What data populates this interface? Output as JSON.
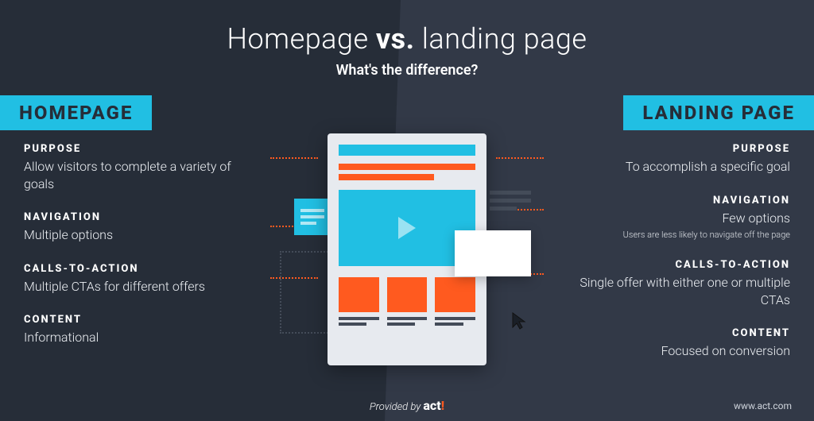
{
  "title_part1": "Homepage ",
  "title_vs": "vs.",
  "title_part2": " landing page",
  "subtitle": "What's the difference?",
  "tabs": {
    "left": "HOMEPAGE",
    "right": "LANDING PAGE"
  },
  "homepage": {
    "purpose": {
      "label": "PURPOSE",
      "text": "Allow visitors to complete a variety of goals"
    },
    "nav": {
      "label": "NAVIGATION",
      "text": "Multiple options"
    },
    "cta": {
      "label": "CALLS-TO-ACTION",
      "text": "Multiple CTAs for different offers"
    },
    "content": {
      "label": "CONTENT",
      "text": "Informational"
    }
  },
  "landing": {
    "purpose": {
      "label": "PURPOSE",
      "text": "To accomplish a specific goal"
    },
    "nav": {
      "label": "NAVIGATION",
      "text": "Few options",
      "sub": "Users are less likely to navigate off the page"
    },
    "cta": {
      "label": "CALLS-TO-ACTION",
      "text": "Single offer with either one or multiple CTAs"
    },
    "content": {
      "label": "CONTENT",
      "text": "Focused on conversion"
    }
  },
  "footer": {
    "provided": "Provided by ",
    "brand": "act",
    "excl": "!"
  },
  "url": "www.act.com",
  "colors": {
    "accent": "#21bfe3",
    "orange": "#ff5a1f",
    "bg_left": "#262d38",
    "bg_right": "#323947"
  }
}
